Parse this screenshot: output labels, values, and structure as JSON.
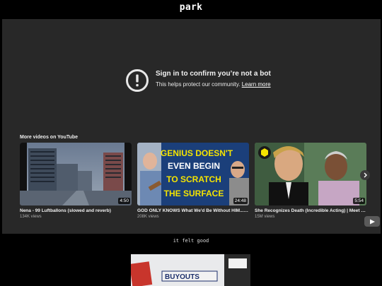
{
  "page": {
    "title": "park",
    "caption": "it felt good"
  },
  "notice": {
    "title": "Sign in to confirm you’re not a bot",
    "subtitle": "This helps protect our community.",
    "link": "Learn more",
    "icon": "alert-circle-icon"
  },
  "more_videos": {
    "label": "More videos on YouTube",
    "items": [
      {
        "title": "Nena - 99 Luftballons (slowed and reverb)",
        "views": "134K views",
        "duration": "4:50"
      },
      {
        "title": "GOD ONLY KNOWS What We'd Be Without HIM...Sa...",
        "views": "208K views",
        "duration": "24:48",
        "thumb_text": [
          "GENIUS DOESN'T",
          "EVEN BEGIN",
          "TO SCRATCH",
          "THE SURFACE"
        ]
      },
      {
        "title": "She Recognizes Death (Incredible Acting) | Meet J...",
        "views": "15M views",
        "duration": "5:54"
      }
    ]
  },
  "icons": {
    "next": "chevron-right-icon",
    "logo": "youtube-logo-icon"
  },
  "colors": {
    "background": "#000000",
    "player_bg": "#282828",
    "thumb_yellow": "#f5e400"
  },
  "below_image_text": [
    "BUYOUTS"
  ]
}
